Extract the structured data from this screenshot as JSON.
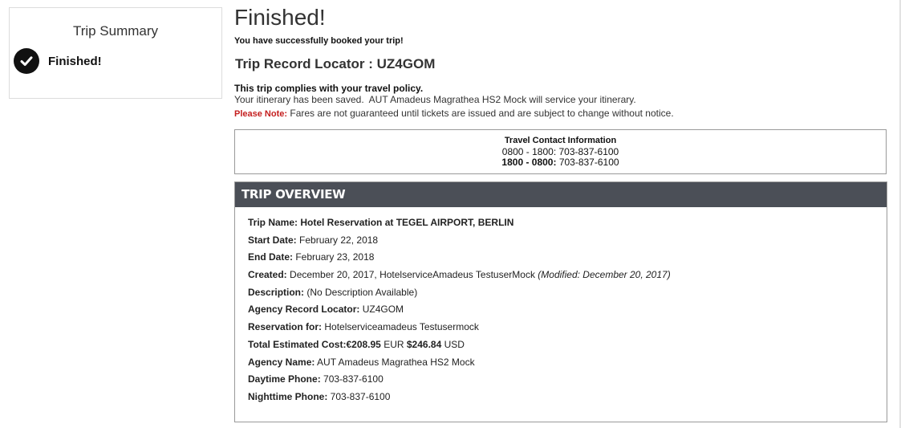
{
  "sidebar": {
    "title": "Trip Summary",
    "step": {
      "label": "Finished!",
      "icon": "check-icon"
    }
  },
  "main": {
    "title": "Finished!",
    "success_message": "You have successfully booked your trip!",
    "record_locator_label": "Trip Record Locator : ",
    "record_locator_value": "UZ4GOM",
    "policy_message": "This trip complies with your travel policy.",
    "saved_message": "Your itinerary has been saved.  AUT Amadeus Magrathea HS2 Mock will service your itinerary.",
    "note_label": "Please Note:",
    "note_text": " Fares are not guaranteed until tickets are issued and are subject to change without notice."
  },
  "contact": {
    "title": "Travel Contact Information",
    "line1": "0800 - 1800: 703-837-6100",
    "line2_label": "1800 - 0800:",
    "line2_value": " 703-837-6100"
  },
  "overview": {
    "header": "TRIP OVERVIEW",
    "trip_name_label": "Trip Name:",
    "trip_name_value": " Hotel Reservation at TEGEL AIRPORT, BERLIN",
    "start_date_label": "Start Date:",
    "start_date_value": " February 22, 2018",
    "end_date_label": "End Date:",
    "end_date_value": " February 23, 2018",
    "created_label": "Created:",
    "created_value": " December 20, 2017, HotelserviceAmadeus TestuserMock ",
    "created_modified": "(Modified: December 20, 2017)",
    "description_label": "Description:",
    "description_value": " (No Description Available)",
    "agency_locator_label": "Agency Record Locator:",
    "agency_locator_value": " UZ4GOM",
    "reservation_for_label": "Reservation for:",
    "reservation_for_value": " Hotelserviceamadeus Testusermock",
    "total_cost_label": "Total Estimated Cost:",
    "total_cost_eur": "€208.95",
    "total_cost_eur_unit": " EUR ",
    "total_cost_usd": "$246.84",
    "total_cost_usd_unit": " USD",
    "agency_name_label": "Agency Name:",
    "agency_name_value": " AUT Amadeus Magrathea HS2 Mock",
    "daytime_phone_label": "Daytime Phone:",
    "daytime_phone_value": " 703-837-6100",
    "nighttime_phone_label": "Nighttime Phone:",
    "nighttime_phone_value": " 703-837-6100"
  }
}
